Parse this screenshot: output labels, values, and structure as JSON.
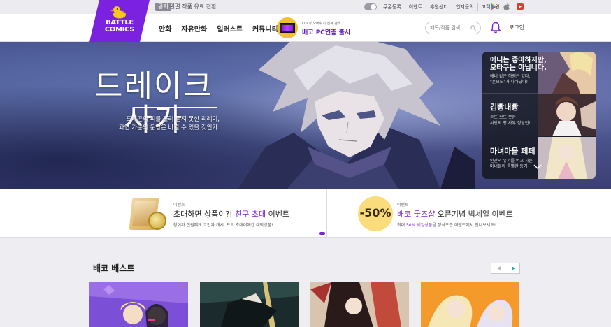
{
  "topbar": {
    "notice_tag": "공지",
    "notice_text": "완결 작품 유료 전환",
    "links": [
      "쿠폰등록",
      "이벤트",
      "후원센터",
      "연재문의",
      "고객지원"
    ],
    "store_icons": [
      "google-play-icon",
      "apple-icon",
      "youtube-icon"
    ]
  },
  "header": {
    "logo_text_1": "BATTLE",
    "logo_text_2": "COMICS",
    "nav": [
      "만화",
      "자유만화",
      "일러스트",
      "커뮤니티"
    ],
    "pc_banner_small": "LOL과 오버워치 전적 검색",
    "pc_banner_big": "배코 PC인증 출시",
    "search_placeholder": "제목/작품 검색",
    "login": "로그인"
  },
  "hero": {
    "title_line1": "드레이크",
    "title_line2": "사가",
    "subtitle_line1": "드래곤의 피를 물려 받지 못한 리레이,",
    "subtitle_line2": "과연 가문의 운명은 바뀔 수 있을 것인가.",
    "side_items": [
      {
        "title": "애니는 좋아하지만,\n오타쿠는 아닙니다.",
        "desc": "애니 같은 하렘은 없다.\n\"흔모노\"가 나타났다!"
      },
      {
        "title": "김빵내빵",
        "desc": "듣도 보도 못한\n사랑의 빵 사투 정탐전!"
      },
      {
        "title": "마녀마을 페페",
        "desc": "인간의 유서를 먹고 사는\n마녀들의 특별한 동거"
      }
    ]
  },
  "events": {
    "left": {
      "tag": "이벤트",
      "title_pre": "초대하면 상품이?! ",
      "title_em": "친구 초대",
      "title_post": " 이벤트",
      "desc": "참여자 전원에게 코인과 캐시, 프로 초대러에겐 대박상품!"
    },
    "right": {
      "tag": "이벤트",
      "badge": "-50%",
      "title_em": "배코 굿즈샵",
      "title_post": " 오픈기념 빅세일 이벤트",
      "desc_pre": "최대 ",
      "desc_em": "50% 세일상품",
      "desc_post": "을 정식오픈 이벤트에서 만나보세요!"
    }
  },
  "best": {
    "title": "배코 베스트"
  },
  "colors": {
    "brand": "#7a22e0",
    "accent_teal": "#2aa6a0",
    "sale_yellow": "#fbdc7c"
  }
}
